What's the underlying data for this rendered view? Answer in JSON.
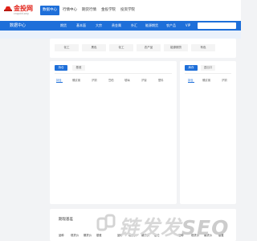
{
  "header": {
    "logo_text": "金投网",
    "logo_domain": "cngold.org",
    "nav": [
      {
        "label": "数据中心",
        "active": true
      },
      {
        "label": "行情中心",
        "active": false
      },
      {
        "label": "期货行情",
        "active": false
      },
      {
        "label": "金投学院",
        "active": false
      },
      {
        "label": "投资学院",
        "active": false
      }
    ]
  },
  "subbar": {
    "title": "数据中心",
    "categories": [
      "期货",
      "基本面",
      "大宗",
      "贵金属",
      "外汇",
      "能源期货",
      "农产品",
      "VIP"
    ]
  },
  "commodity_chips": [
    "化工",
    "黑色",
    "化工",
    "农产品",
    "能源期货",
    "有色"
  ],
  "left_panel": {
    "tabs": [
      {
        "label": "持仓",
        "active": true
      },
      {
        "label": "基差",
        "active": false
      }
    ],
    "filters": [
      "持仓",
      "螺纹钢",
      "沪铜",
      "豆粕",
      "玻璃",
      "沪镍",
      "塑料"
    ]
  },
  "right_panel": {
    "tabs": [
      {
        "label": "库存",
        "active": true
      },
      {
        "label": "进出口",
        "active": false
      }
    ],
    "filters": [
      "持仓",
      "螺纹钢",
      "沪铜"
    ]
  },
  "bottom_panel": {
    "title": "期现基差",
    "columns": [
      "品种",
      "现货价",
      "期货价",
      "基差",
      "品种",
      "现货价",
      "期货价",
      "基差",
      "品种",
      "现货价",
      "期货价",
      "基差"
    ]
  },
  "watermark": {
    "text": "链发发",
    "suffix": "SEO"
  },
  "colors": {
    "primary": "#1e6fd9",
    "logo_red": "#e2231a"
  }
}
